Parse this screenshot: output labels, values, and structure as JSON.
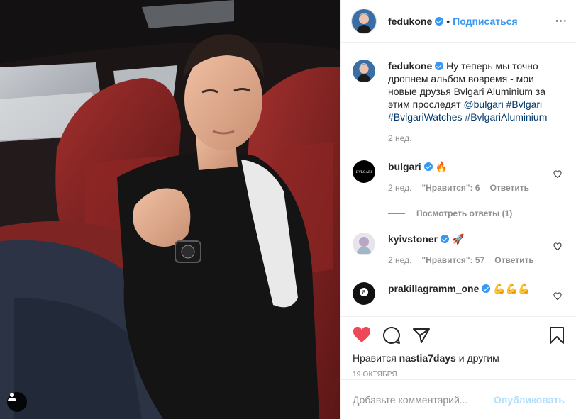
{
  "post": {
    "username": "fedukone",
    "follow_label": "Подписаться",
    "dot": "•",
    "more": "···"
  },
  "caption": {
    "username": "fedukone",
    "text": "Ну теперь мы точно дропнем альбом вовремя - мои новые друзья Bvlgari Aluminium за этим проследят",
    "mention": "@bulgari",
    "hashtags": [
      "#Bvlgari",
      "#BvlgariWatches",
      "#BvlgariAluminium"
    ],
    "time": "2 нед."
  },
  "comments": [
    {
      "username": "bulgari",
      "emoji": "🔥",
      "time": "2 нед.",
      "likes": "\"Нравится\": 6",
      "reply": "Ответить",
      "view_replies": "Посмотреть ответы (1)"
    },
    {
      "username": "kyivstoner",
      "emoji": "🚀",
      "time": "2 нед.",
      "likes": "\"Нравится\": 57",
      "reply": "Ответить"
    },
    {
      "username": "prakillagramm_one",
      "emoji": "💪💪💪"
    }
  ],
  "likes_line": {
    "prefix": "Нравится",
    "user": "nastia7days",
    "suffix": "и другим"
  },
  "post_date": "19 ОКТЯБРЯ",
  "add_comment": {
    "placeholder": "Добавьте комментарий...",
    "post_label": "Опубликовать"
  },
  "icons": {
    "like": "heart-icon",
    "comment": "comment-icon",
    "share": "share-icon",
    "save": "bookmark-icon",
    "tag": "user-tag-icon"
  },
  "colors": {
    "link": "#3897f0",
    "heart": "#ed4956",
    "muted": "#8e8e8e",
    "post_disabled": "#b2dffc"
  }
}
